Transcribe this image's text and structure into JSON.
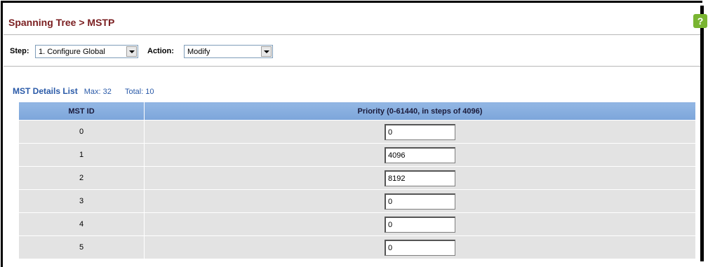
{
  "header": {
    "title": "Spanning Tree > MSTP",
    "help_symbol": "?",
    "help_color": "#79b531"
  },
  "toolbar": {
    "step_label": "Step:",
    "step_value": "1. Configure Global",
    "action_label": "Action:",
    "action_value": "Modify"
  },
  "list": {
    "title": "MST Details List",
    "max": "Max: 32",
    "total": "Total: 10",
    "columns": [
      "MST ID",
      "Priority (0-61440, in steps of 4096)"
    ],
    "rows": [
      {
        "id": "0",
        "priority": "0"
      },
      {
        "id": "1",
        "priority": "4096"
      },
      {
        "id": "2",
        "priority": "8192"
      },
      {
        "id": "3",
        "priority": "0"
      },
      {
        "id": "4",
        "priority": "0"
      },
      {
        "id": "5",
        "priority": "0"
      }
    ]
  }
}
